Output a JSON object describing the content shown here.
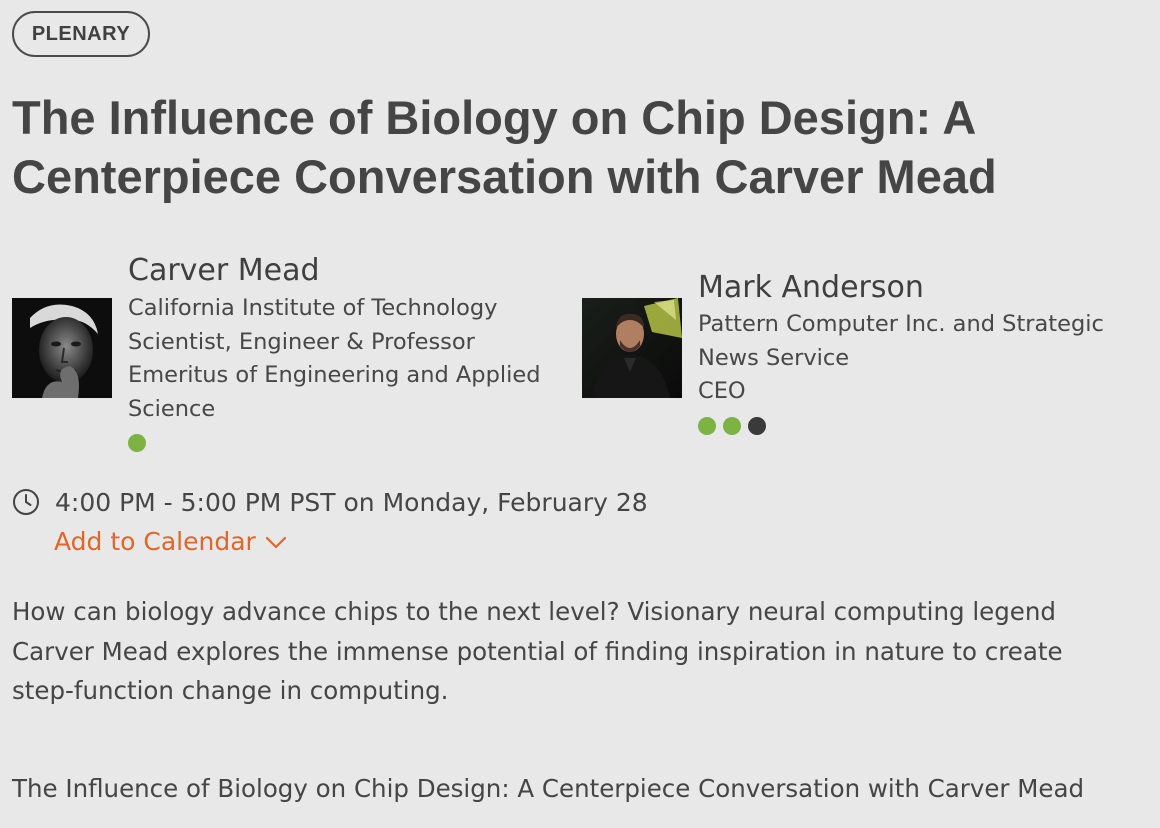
{
  "session": {
    "type_badge": "PLENARY",
    "title_lines": [
      "The Influence of Biology on Chip Design: A",
      "Centerpiece Conversation with Carver Mead"
    ]
  },
  "speakers": [
    {
      "name": "Carver Mead",
      "info_lines": [
        "California Institute of Technology",
        "Scientist, Engineer & Professor",
        "Emeritus of Engineering and Applied",
        "Science"
      ],
      "dot_colors": [
        "#7cb342"
      ]
    },
    {
      "name": "Mark Anderson",
      "info_lines": [
        "Pattern Computer Inc. and Strategic",
        "News Service",
        "CEO"
      ],
      "dot_colors": [
        "#7cb342",
        "#7cb342",
        "#3a3a3a"
      ]
    }
  ],
  "schedule": {
    "time_text": "4:00 PM - 5:00 PM PST on Monday, February 28",
    "add_to_calendar": "Add to Calendar",
    "link_color": "#e0662a"
  },
  "description_lines": [
    "How can biology advance chips to the next level? Visionary neural computing legend",
    "Carver Mead explores the immense potential of finding inspiration in nature to create",
    "step-function change in computing."
  ],
  "repeat_title": "The Influence of Biology on Chip Design: A Centerpiece Conversation with Carver Mead"
}
